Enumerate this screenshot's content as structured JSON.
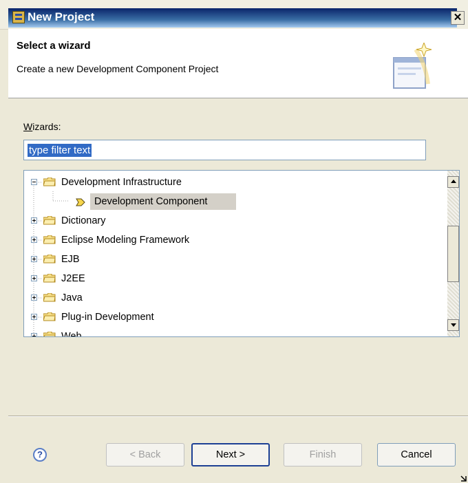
{
  "window": {
    "title": "New Project",
    "close_glyph": "✕"
  },
  "banner": {
    "heading": "Select a wizard",
    "description": "Create a new Development Component Project"
  },
  "wizards": {
    "label_prefix": "W",
    "label_rest": "izards:",
    "filter_value": "type filter text"
  },
  "tree": {
    "items": [
      {
        "label": "Development Infrastructure",
        "expanded": true,
        "level": 0
      },
      {
        "label": "Development Component",
        "level": 1,
        "selected": true
      },
      {
        "label": "Dictionary",
        "expanded": false,
        "level": 0
      },
      {
        "label": "Eclipse Modeling Framework",
        "expanded": false,
        "level": 0
      },
      {
        "label": "EJB",
        "expanded": false,
        "level": 0
      },
      {
        "label": "J2EE",
        "expanded": false,
        "level": 0
      },
      {
        "label": "Java",
        "expanded": false,
        "level": 0
      },
      {
        "label": "Plug-in Development",
        "expanded": false,
        "level": 0
      },
      {
        "label": "Web",
        "expanded": false,
        "level": 0
      }
    ]
  },
  "buttons": {
    "help": "?",
    "back": "< Back",
    "next": "Next >",
    "finish": "Finish",
    "cancel": "Cancel"
  },
  "icons": [
    "app-icon",
    "close-icon",
    "wizard-banner-icon",
    "folder-icon",
    "development-component-icon",
    "help-icon",
    "resize-grip-icon"
  ]
}
